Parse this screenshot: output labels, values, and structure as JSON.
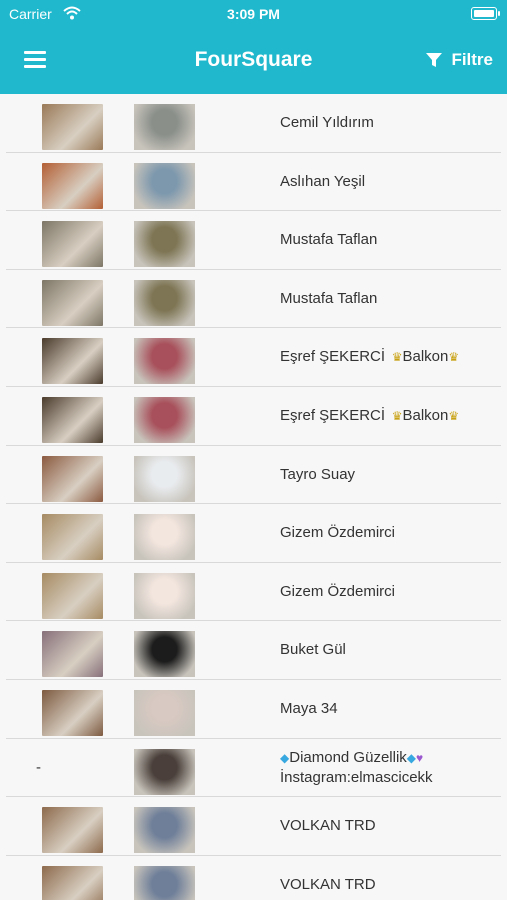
{
  "status": {
    "carrier": "Carrier",
    "time": "3:09 PM"
  },
  "header": {
    "title": "FourSquare",
    "filter_label": "Filtre"
  },
  "icons": {
    "menu": "hamburger-menu-icon",
    "filter": "funnel-icon",
    "wifi": "wifi-icon",
    "battery": "battery-icon"
  },
  "colors": {
    "header": "#1fb8cc",
    "text": "#333333",
    "divider": "#d9d9d9"
  },
  "rows": [
    {
      "name": "Cemil Yıldırım",
      "venue": "#9a7a58",
      "avatar": "#8a8f8a"
    },
    {
      "name": "Aslıhan Yeşil",
      "venue": "#b35f34",
      "avatar": "#7d98ad"
    },
    {
      "name": "Mustafa Taflan",
      "venue": "#7d7565",
      "avatar": "#7e7554"
    },
    {
      "name": "Mustafa Taflan",
      "venue": "#7d7565",
      "avatar": "#7e7554"
    },
    {
      "name": "Eşref ŞEKERCİ",
      "badge": "Balkon",
      "venue": "#4a3b2c",
      "avatar": "#a8505b"
    },
    {
      "name": "Eşref ŞEKERCİ",
      "badge": "Balkon",
      "venue": "#4a3b2c",
      "avatar": "#a8505b"
    },
    {
      "name": "Tayro Suay",
      "venue": "#8b5a40",
      "avatar": "#e9ecef"
    },
    {
      "name": "Gizem Özdemirci",
      "venue": "#a68b63",
      "avatar": "#f3e6df"
    },
    {
      "name": "Gizem Özdemirci",
      "venue": "#a68b63",
      "avatar": "#f3e6df"
    },
    {
      "name": "Buket Gül",
      "venue": "#87707a",
      "avatar": "#1c1c1c"
    },
    {
      "name": "Maya 34",
      "venue": "#7d5a40",
      "avatar": "#d8c9c2"
    },
    {
      "name": "Diamond Güzellik",
      "line2": "İnstagram:elmascicekk",
      "venue": null,
      "dash": "-",
      "avatar": "#4a3f3a"
    },
    {
      "name": "VOLKAN TRD",
      "venue": "#8d6a4c",
      "avatar": "#6f7f99"
    },
    {
      "name": "VOLKAN TRD",
      "venue": "#8d6a4c",
      "avatar": "#6f7f99"
    }
  ]
}
